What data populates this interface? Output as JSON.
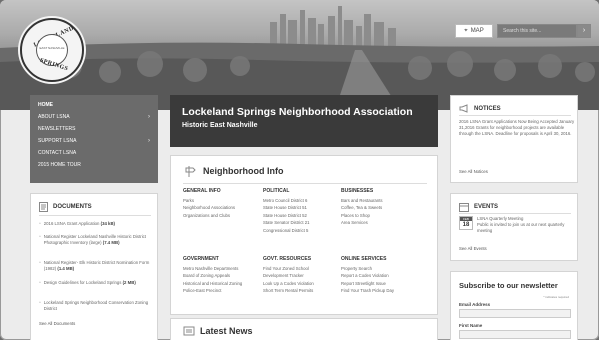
{
  "header": {
    "logo": {
      "top_text": "LOCKELAND",
      "bottom_text": "SPRINGS",
      "inner_text": "EAST NASHVILLE"
    },
    "map_label": "MAP",
    "search_placeholder": "Search this site..."
  },
  "nav": {
    "items": [
      {
        "label": "HOME",
        "arrow": ""
      },
      {
        "label": "ABOUT LSNA",
        "arrow": "›"
      },
      {
        "label": "NEWSLETTERS",
        "arrow": ""
      },
      {
        "label": "SUPPORT LSNA",
        "arrow": "›"
      },
      {
        "label": "CONTACT LSNA",
        "arrow": ""
      },
      {
        "label": "2015 HOME TOUR",
        "arrow": ""
      }
    ]
  },
  "banner": {
    "title": "Lockeland Springs Neighborhood Association",
    "subtitle": "Historic East Nashville"
  },
  "neighborhood_info": {
    "title": "Neighborhood Info",
    "columns": [
      {
        "heading": "GENERAL INFO",
        "links": [
          "Parks",
          "Neighborhood Associations",
          "Organizations and Clubs"
        ]
      },
      {
        "heading": "POLITICAL",
        "links": [
          "Metro Council District 6",
          "State House District 51",
          "State House District 52",
          "State Senator District 21",
          "Congressional District 5"
        ]
      },
      {
        "heading": "BUSINESSES",
        "links": [
          "Bars and Restaurants",
          "Coffee, Tea & Sweets",
          "Places to Shop",
          "Area Services"
        ]
      },
      {
        "heading": "GOVERNMENT",
        "links": [
          "Metro Nashville Departments",
          "Board of Zoning Appeals",
          "Historical and Historical Zoning",
          "Police-East Precinct"
        ]
      },
      {
        "heading": "GOVT. RESOURCES",
        "links": [
          "Find Your Zoned School",
          "Development Tracker",
          "Look Up a Codes Violation",
          "Short Term Rental Permits"
        ]
      },
      {
        "heading": "ONLINE SERVICES",
        "links": [
          "Property Search",
          "Report a Codes Violation",
          "Report Streetlight Issue",
          "Find Your Trash Pickup Day"
        ]
      }
    ]
  },
  "latest_news": {
    "title": "Latest News"
  },
  "documents": {
    "title": "DOCUMENTS",
    "items": [
      {
        "text": "2016 LSNA Grant Application",
        "size": "(34 kB)"
      },
      {
        "text": "National Register Lockeland Nashville Historic District Photographic Inventory (large)",
        "size": "(7.4 MB)"
      },
      {
        "text": "National Register- Elk Historic District Nomination Form (1982)",
        "size": "(1.4 MB)"
      },
      {
        "text": "Design Guidelines for Lockeland Springs",
        "size": "(2 MB)"
      },
      {
        "text": "Lockeland Springs Neighborhood Conservation Zoning District",
        "size": ""
      }
    ],
    "see_all": "See All Documents"
  },
  "notices": {
    "title": "NOTICES",
    "text": "2016 LSNA Grant Applications Now Being Accepted January 31,2016 Grants for neighborhood projects are available through the LSNA. Deadline for proposals is April 30, 2016.",
    "see_all": "See All Notices"
  },
  "events": {
    "title": "EVENTS",
    "cal_month": "FEB",
    "cal_day": "18",
    "event_title": "LSNA Quarterly Meeting",
    "event_text": "Public is invited to join us at our next quarterly meeting",
    "see_all": "See All Events"
  },
  "newsletter": {
    "title": "Subscribe to our newsletter",
    "required": "* indicates required",
    "email_label": "Email Address",
    "first_name_label": "First Name"
  }
}
